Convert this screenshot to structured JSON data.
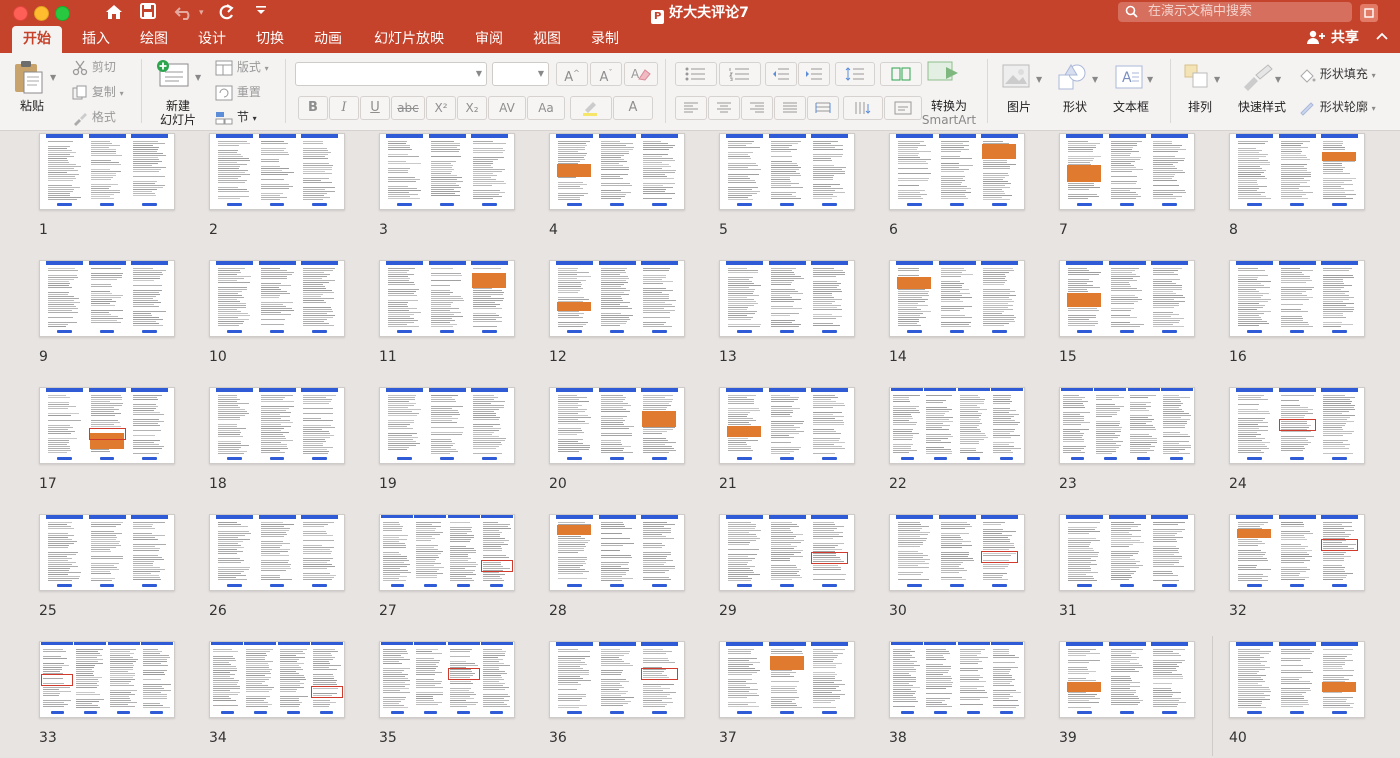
{
  "window": {
    "title": "好大夫评论7",
    "search_placeholder": "在演示文稿中搜索"
  },
  "quick_access": {
    "home": "⌂",
    "save": "💾",
    "undo": "↶",
    "redo": "↺",
    "more": "⌄"
  },
  "tabs": [
    {
      "label": "开始",
      "active": true
    },
    {
      "label": "插入"
    },
    {
      "label": "绘图"
    },
    {
      "label": "设计"
    },
    {
      "label": "切换"
    },
    {
      "label": "动画"
    },
    {
      "label": "幻灯片放映"
    },
    {
      "label": "审阅"
    },
    {
      "label": "视图"
    },
    {
      "label": "录制"
    }
  ],
  "share_label": "共享",
  "ribbon": {
    "paste": "粘贴",
    "cut": "剪切",
    "copy": "复制",
    "format": "格式",
    "new_slide_line1": "新建",
    "new_slide_line2": "幻灯片",
    "layout": "版式",
    "reset": "重置",
    "section": "节",
    "convert_line1": "转换为",
    "convert_line2": "SmartArt",
    "picture": "图片",
    "shape": "形状",
    "textbox": "文本框",
    "arrange": "排列",
    "quick_styles": "快速样式",
    "shape_fill": "形状填充",
    "shape_outline": "形状轮廓",
    "font_buttons": [
      "B",
      "I",
      "U",
      "abc",
      "X²",
      "X₂",
      "AV",
      "Aa",
      "A"
    ],
    "font_grow": "A^",
    "font_shrink": "Aˇ"
  },
  "slides": [
    {
      "n": "1"
    },
    {
      "n": "2"
    },
    {
      "n": "3"
    },
    {
      "n": "4"
    },
    {
      "n": "5"
    },
    {
      "n": "6"
    },
    {
      "n": "7"
    },
    {
      "n": "8"
    },
    {
      "n": "9"
    },
    {
      "n": "10"
    },
    {
      "n": "11"
    },
    {
      "n": "12"
    },
    {
      "n": "13"
    },
    {
      "n": "14"
    },
    {
      "n": "15"
    },
    {
      "n": "16"
    },
    {
      "n": "17"
    },
    {
      "n": "18"
    },
    {
      "n": "19"
    },
    {
      "n": "20"
    },
    {
      "n": "21"
    },
    {
      "n": "22"
    },
    {
      "n": "23"
    },
    {
      "n": "24"
    },
    {
      "n": "25"
    },
    {
      "n": "26"
    },
    {
      "n": "27"
    },
    {
      "n": "28"
    },
    {
      "n": "29"
    },
    {
      "n": "30"
    },
    {
      "n": "31"
    },
    {
      "n": "32"
    },
    {
      "n": "33"
    },
    {
      "n": "34"
    },
    {
      "n": "35"
    },
    {
      "n": "36"
    },
    {
      "n": "37"
    },
    {
      "n": "38"
    },
    {
      "n": "39"
    },
    {
      "n": "40"
    }
  ],
  "colors": {
    "accent": "#c5422b",
    "slide_header_blue": "#2f5cd6",
    "highlight_orange": "#e07a2f"
  }
}
